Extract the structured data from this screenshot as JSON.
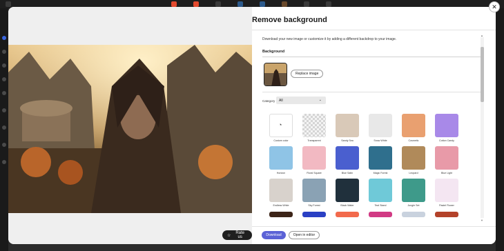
{
  "modal": {
    "title": "Remove background",
    "description": "Download your new image or customize it by adding a different backdrop to your image.",
    "background_section_title": "Background",
    "replace_button": "Replace image",
    "category_label": "Category",
    "category_value": "All",
    "download_button": "Download",
    "open_editor_button": "Open in editor",
    "rate_button": "Rate us",
    "close_icon": "close-icon"
  },
  "backdrops": [
    {
      "label": "Custom color",
      "color": "#ffffff"
    },
    {
      "label": "Transparent",
      "color": "#dcdcdc"
    },
    {
      "label": "Sandy Sea",
      "color": "#d9c9b8"
    },
    {
      "label": "Snow White",
      "color": "#e8e8e8"
    },
    {
      "label": "Cosmetic",
      "color": "#e9a070"
    },
    {
      "label": "Cotton Candy",
      "color": "#a889e8"
    },
    {
      "label": "Horizon",
      "color": "#8fc4e6"
    },
    {
      "label": "Floral Square",
      "color": "#f2b9c2"
    },
    {
      "label": "Blue Satin",
      "color": "#4a5fcf"
    },
    {
      "label": "Magic Forest",
      "color": "#2f6f8d"
    },
    {
      "label": "Leopard",
      "color": "#b08a5a"
    },
    {
      "label": "Blue Light",
      "color": "#e89aa8"
    },
    {
      "label": "Endless White",
      "color": "#d8d2cc"
    },
    {
      "label": "Sky Forest",
      "color": "#8aa2b4"
    },
    {
      "label": "Black Water",
      "color": "#20303c"
    },
    {
      "label": "Teal Stand",
      "color": "#6fc9d8"
    },
    {
      "label": "Jungle Set",
      "color": "#3e9a8a"
    },
    {
      "label": "Pastel Flower",
      "color": "#f4e6f2"
    },
    {
      "label": "",
      "color": "#3c2418"
    },
    {
      "label": "",
      "color": "#2a40c4"
    },
    {
      "label": "",
      "color": "#f26a4c"
    },
    {
      "label": "",
      "color": "#d13a84"
    },
    {
      "label": "",
      "color": "#c9d2de"
    },
    {
      "label": "",
      "color": "#b3422a"
    }
  ]
}
